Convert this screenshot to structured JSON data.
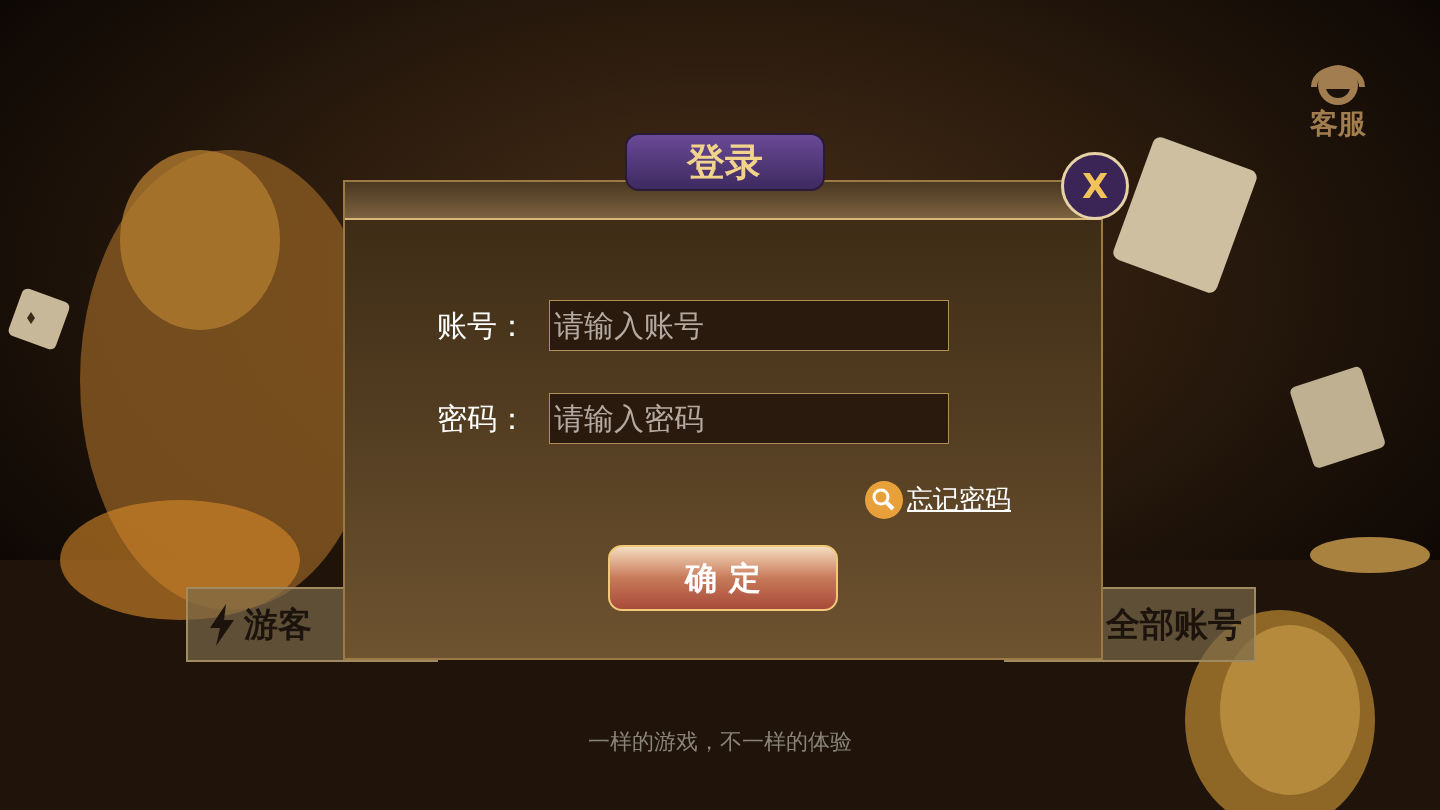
{
  "customer_service": {
    "label": "客服"
  },
  "background_buttons": [
    {
      "kind": "guest",
      "label": "游客"
    },
    {
      "kind": "all",
      "label": "全部账号"
    }
  ],
  "tagline": "一样的游戏，不一样的体验",
  "dialog": {
    "title": "登录",
    "close": "X",
    "fields": [
      {
        "label": "账号：",
        "placeholder": "请输入账号"
      },
      {
        "label": "密码：",
        "placeholder": "请输入密码"
      }
    ],
    "forgot_link": "忘记密码",
    "confirm_button": "确 定"
  }
}
